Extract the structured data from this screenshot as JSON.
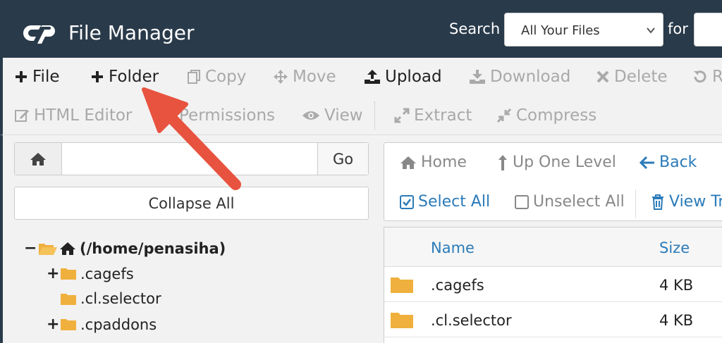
{
  "header": {
    "title": "File Manager",
    "search_label": "Search",
    "search_scope": "All Your Files",
    "for_label": "for",
    "bg_color": "#293a4a"
  },
  "toolbar": {
    "row1": [
      {
        "label": "File",
        "icon": "plus-icon",
        "enabled": true
      },
      {
        "label": "Folder",
        "icon": "plus-icon",
        "enabled": true
      },
      {
        "label": "Copy",
        "icon": "copy-icon",
        "enabled": false
      },
      {
        "label": "Move",
        "icon": "move-icon",
        "enabled": false
      },
      {
        "label": "Upload",
        "icon": "upload-icon",
        "enabled": true
      },
      {
        "label": "Download",
        "icon": "download-icon",
        "enabled": false
      },
      {
        "label": "Delete",
        "icon": "close-icon",
        "enabled": false
      },
      {
        "label": "R",
        "icon": "restore-icon",
        "enabled": false
      }
    ],
    "row2": [
      {
        "label": "HTML Editor",
        "icon": "edit-icon",
        "enabled": false
      },
      {
        "label": "Permissions",
        "icon": "key-icon",
        "enabled": false
      },
      {
        "label": "View",
        "icon": "eye-icon",
        "enabled": false
      },
      {
        "label": "Extract",
        "icon": "expand-icon",
        "enabled": false
      },
      {
        "label": "Compress",
        "icon": "compress-icon",
        "enabled": false
      }
    ]
  },
  "left_panel": {
    "go_label": "Go",
    "path_value": "",
    "collapse_label": "Collapse All",
    "tree": [
      {
        "toggle": "−",
        "label": "(/home/penasiha)",
        "root": true
      },
      {
        "toggle": "+",
        "label": ".cagefs"
      },
      {
        "toggle": "",
        "label": ".cl.selector"
      },
      {
        "toggle": "+",
        "label": ".cpaddons"
      }
    ]
  },
  "right_panel": {
    "nav": {
      "home": "Home",
      "up": "Up One Level",
      "back": "Back",
      "select_all": "Select All",
      "unselect_all": "Unselect All",
      "view_trash": "View Tr"
    },
    "table": {
      "col_name": "Name",
      "col_size": "Size",
      "rows": [
        {
          "name": ".cagefs",
          "size": "4 KB"
        },
        {
          "name": ".cl.selector",
          "size": "4 KB"
        }
      ]
    }
  },
  "colors": {
    "accent_blue": "#2b7bb9",
    "folder": "#f0b03d",
    "arrow": "#e8533f"
  }
}
